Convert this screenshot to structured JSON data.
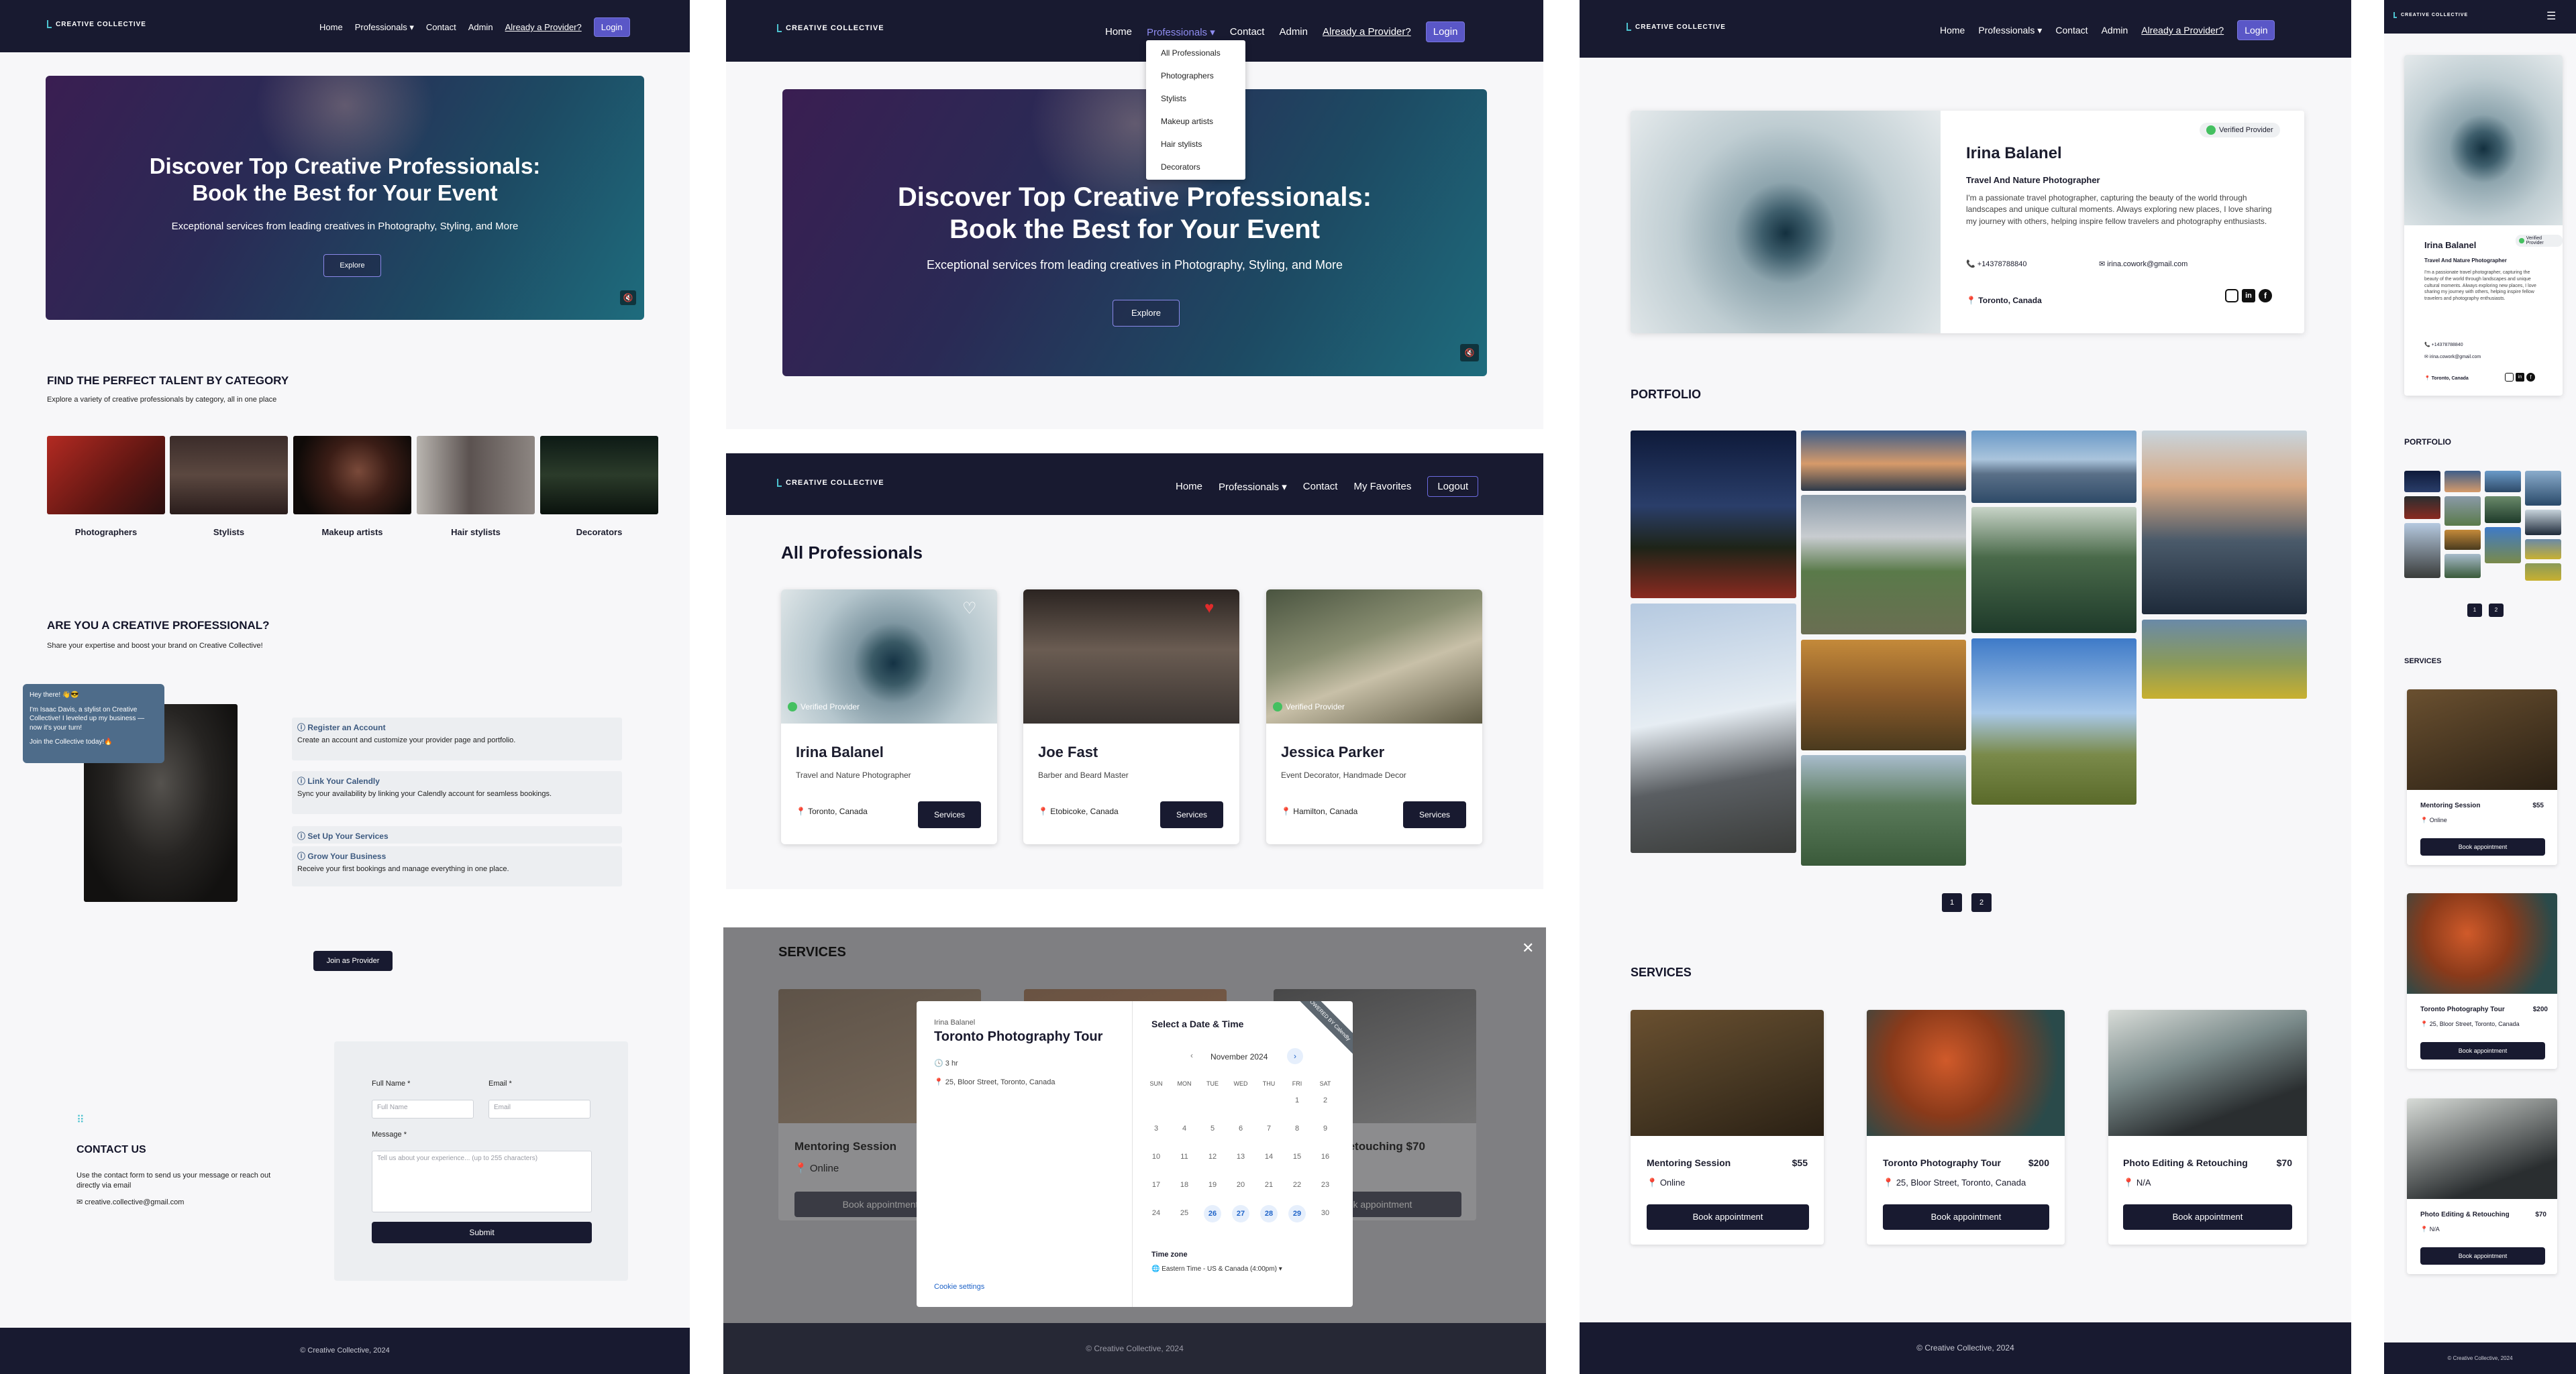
{
  "brand": "CREATIVE COLLECTIVE",
  "nav": {
    "home": "Home",
    "professionals": "Professionals",
    "contact": "Contact",
    "admin": "Admin",
    "provider": "Already a Provider?",
    "login": "Login",
    "favorites": "My Favorites",
    "logout": "Logout"
  },
  "dropdown": [
    "All Professionals",
    "Photographers",
    "Stylists",
    "Makeup artists",
    "Hair stylists",
    "Decorators"
  ],
  "hero": {
    "title_line1": "Discover Top Creative Professionals:",
    "title_line2": "Book the Best for Your Event",
    "subtitle": "Exceptional services from leading creatives in Photography, Styling, and More",
    "explore": "Explore"
  },
  "categories": {
    "heading": "FIND THE PERFECT TALENT BY CATEGORY",
    "sub": "Explore a variety of creative professionals by category, all in one place",
    "items": [
      "Photographers",
      "Stylists",
      "Makeup artists",
      "Hair stylists",
      "Decorators"
    ]
  },
  "provider": {
    "heading": "ARE YOU A CREATIVE PROFESSIONAL?",
    "sub": "Share your expertise and boost your brand on Creative Collective!",
    "chat_hello": "Hey there! 👋😎",
    "chat_body": "I'm Isaac Davis, a stylist on Creative Collective! I leveled up my business — now it's your turn!",
    "chat_cta": "Join the Collective today!🔥",
    "steps": [
      {
        "title": "Register an Account",
        "desc": "Create an account and customize your provider page and portfolio."
      },
      {
        "title": "Link Your Calendly",
        "desc": "Sync your availability by linking your Calendly account for seamless bookings."
      },
      {
        "title": "Set Up Your Services",
        "desc": ""
      },
      {
        "title": "Grow Your Business",
        "desc": "Receive your first bookings and manage everything in one place."
      }
    ],
    "join": "Join as Provider"
  },
  "contact": {
    "heading": "CONTACT US",
    "text": "Use the contact form to send us your message or reach out directly via email",
    "email": "creative.collective@gmail.com",
    "full_name_label": "Full Name *",
    "full_name_ph": "Full Name",
    "email_label": "Email *",
    "email_ph": "Email",
    "message_label": "Message *",
    "message_ph": "Tell us about your experience... (up to 255 characters)",
    "submit": "Submit"
  },
  "footer": "© Creative Collective, 2024",
  "all_pros": {
    "heading": "All Professionals",
    "cards": [
      {
        "name": "Irina Balanel",
        "role": "Travel and Nature Photographer",
        "loc": "Toronto, Canada",
        "verified": "Verified Provider",
        "btn": "Services"
      },
      {
        "name": "Joe Fast",
        "role": "Barber and Beard Master",
        "loc": "Etobicoke, Canada",
        "verified": "",
        "btn": "Services"
      },
      {
        "name": "Jessica Parker",
        "role": "Event Decorator, Handmade Decor",
        "loc": "Hamilton, Canada",
        "verified": "Verified Provider",
        "btn": "Services"
      }
    ]
  },
  "modal": {
    "services_heading": "SERVICES",
    "owner": "Irina Balanel",
    "title": "Toronto Photography Tour",
    "duration": "3 hr",
    "address": "25, Bloor Street, Toronto, Canada",
    "cookie": "Cookie settings",
    "select": "Select a Date & Time",
    "month": "November 2024",
    "dow": [
      "SUN",
      "MON",
      "TUE",
      "WED",
      "THU",
      "FRI",
      "SAT"
    ],
    "days": [
      "",
      "",
      "",
      "",
      "",
      "1",
      "2",
      "3",
      "4",
      "5",
      "6",
      "7",
      "8",
      "9",
      "10",
      "11",
      "12",
      "13",
      "14",
      "15",
      "16",
      "17",
      "18",
      "19",
      "20",
      "21",
      "22",
      "23",
      "24",
      "25",
      "26",
      "27",
      "28",
      "29",
      "30"
    ],
    "available": [
      "26",
      "27",
      "28",
      "29"
    ],
    "tz_label": "Time zone",
    "tz": "Eastern Time - US & Canada (4:00pm) ▾",
    "ribbon": "POWERED BY Calendly",
    "bg_services": [
      "Mentoring Session",
      "Online",
      "Book appointment",
      "Editing & Retouching $70",
      "Book appointment"
    ]
  },
  "profile": {
    "name": "Irina Balanel",
    "verified": "Verified Provider",
    "title": "Travel And Nature Photographer",
    "bio": "I'm a passionate travel photographer, capturing the beauty of the world through landscapes and unique cultural moments. Always exploring new places, I love sharing my journey with others, helping inspire fellow travelers and photography enthusiasts.",
    "phone": "+14378788840",
    "email": "irina.cowork@gmail.com",
    "location": "Toronto, Canada",
    "portfolio": "PORTFOLIO",
    "pages": [
      "1",
      "2"
    ],
    "services_heading": "SERVICES",
    "services": [
      {
        "title": "Mentoring Session",
        "price": "$55",
        "loc": "Online",
        "btn": "Book appointment"
      },
      {
        "title": "Toronto Photography Tour",
        "price": "$200",
        "loc": "25, Bloor Street, Toronto, Canada",
        "btn": "Book appointment"
      },
      {
        "title": "Photo Editing & Retouching",
        "price": "$70",
        "loc": "N/A",
        "btn": "Book appointment"
      }
    ]
  },
  "mobile": {
    "name": "Irina Balanel",
    "verified": "Verified Provider",
    "title": "Travel And Nature Photographer",
    "bio": "I'm a passionate travel photographer, capturing the beauty of the world through landscapes and unique cultural moments. Always exploring new places, I love sharing my journey with others, helping inspire fellow travelers and photography enthusiasts.",
    "phone": "+14378788840",
    "email": "irina.cowork@gmail.com",
    "location": "Toronto, Canada",
    "portfolio": "PORTFOLIO",
    "pages": [
      "1",
      "2"
    ],
    "services_heading": "SERVICES",
    "footer": "© Creative Collective, 2024"
  },
  "colors": {
    "navy": "#181a30",
    "accent": "#5a57c7",
    "teal": "#4cc2cf",
    "green": "#44c060",
    "link_blue": "#1e63c8"
  }
}
